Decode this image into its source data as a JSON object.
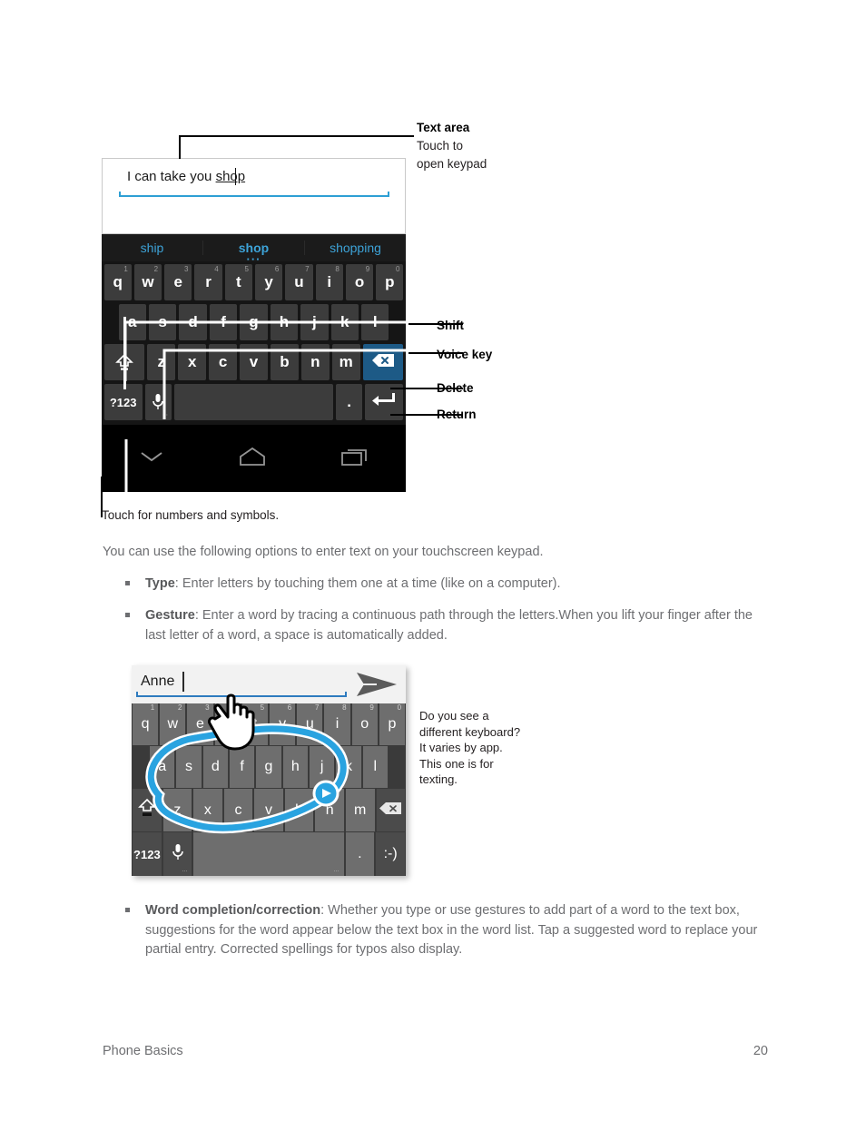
{
  "figure1": {
    "textarea": {
      "text_before": "I can take you ",
      "text_underlined": "shop"
    },
    "suggestions": [
      {
        "label": "ship",
        "active": false
      },
      {
        "label": "shop",
        "active": true
      },
      {
        "label": "shopping",
        "active": false
      }
    ],
    "rows": {
      "row1": [
        {
          "key": "q",
          "num": "1"
        },
        {
          "key": "w",
          "num": "2"
        },
        {
          "key": "e",
          "num": "3"
        },
        {
          "key": "r",
          "num": "4"
        },
        {
          "key": "t",
          "num": "5"
        },
        {
          "key": "y",
          "num": "6"
        },
        {
          "key": "u",
          "num": "7"
        },
        {
          "key": "i",
          "num": "8"
        },
        {
          "key": "o",
          "num": "9"
        },
        {
          "key": "p",
          "num": "0"
        }
      ],
      "row2": [
        {
          "key": "a"
        },
        {
          "key": "s"
        },
        {
          "key": "d"
        },
        {
          "key": "f"
        },
        {
          "key": "g"
        },
        {
          "key": "h"
        },
        {
          "key": "j"
        },
        {
          "key": "k"
        },
        {
          "key": "l"
        }
      ],
      "row3": [
        {
          "key": "shift"
        },
        {
          "key": "z"
        },
        {
          "key": "x"
        },
        {
          "key": "c"
        },
        {
          "key": "v"
        },
        {
          "key": "b"
        },
        {
          "key": "n"
        },
        {
          "key": "m"
        },
        {
          "key": "delete"
        }
      ],
      "row4": [
        {
          "key": "?123"
        },
        {
          "key": "mic"
        },
        {
          "key": "space"
        },
        {
          "key": "."
        },
        {
          "key": "return"
        }
      ]
    },
    "navbar": [
      "hide-keyboard-icon",
      "home-icon",
      "recents-icon"
    ],
    "callouts": [
      {
        "title": "Text area",
        "sub1": "Touch to",
        "sub2": "open keypad"
      },
      {
        "title": "Shift"
      },
      {
        "title": "Voice key"
      },
      {
        "title": "Delete"
      },
      {
        "title": "Return"
      }
    ],
    "caption": "Touch for numbers and symbols."
  },
  "body": {
    "intro": "You can use the following options to enter text on your touchscreen keypad.",
    "bullets": [
      {
        "term": "Type",
        "text": ": Enter letters by touching them one at a time (like on a computer)."
      },
      {
        "term": "Gesture",
        "text": ": Enter a word by tracing a continuous path through the letters.When you lift your finger after the last letter of a word, a space is automatically added."
      },
      {
        "term": "Word completion/correction",
        "text": ": Whether you type or use gestures to add part of a word to the text box, suggestions for the word appear below the text box in the word list. Tap a suggested word to replace your partial entry. Corrected spellings for typos also display."
      }
    ]
  },
  "figure2": {
    "textarea": {
      "text": "Anne"
    },
    "send_icon": "send-icon",
    "rows": {
      "row1": [
        {
          "key": "q",
          "num": "1"
        },
        {
          "key": "w",
          "num": "2"
        },
        {
          "key": "e",
          "num": "3"
        },
        {
          "key": "r",
          "num": "4"
        },
        {
          "key": "t",
          "num": "5"
        },
        {
          "key": "y",
          "num": "6"
        },
        {
          "key": "u",
          "num": "7"
        },
        {
          "key": "i",
          "num": "8"
        },
        {
          "key": "o",
          "num": "9"
        },
        {
          "key": "p",
          "num": "0"
        }
      ],
      "row2": [
        {
          "key": "a"
        },
        {
          "key": "s"
        },
        {
          "key": "d"
        },
        {
          "key": "f"
        },
        {
          "key": "g"
        },
        {
          "key": "h"
        },
        {
          "key": "j"
        },
        {
          "key": "k"
        },
        {
          "key": "l"
        }
      ],
      "row3": [
        {
          "key": "shift"
        },
        {
          "key": "z"
        },
        {
          "key": "x"
        },
        {
          "key": "c"
        },
        {
          "key": "v"
        },
        {
          "key": "b"
        },
        {
          "key": "n"
        },
        {
          "key": "m"
        },
        {
          "key": "delete"
        }
      ],
      "row4": [
        {
          "key": "?123"
        },
        {
          "key": "mic"
        },
        {
          "key": "space"
        },
        {
          "key": "."
        },
        {
          "key": ":-)"
        }
      ]
    },
    "note": "Do you see a different keyboard? It varies by app. This one is for texting.",
    "gesture_trace_color": "#29a3e0"
  },
  "footer": {
    "section": "Phone Basics",
    "page": "20"
  },
  "colors": {
    "accent_blue": "#3da3d8",
    "delete_key_blue": "#1d5a86",
    "gesture_blue": "#29a3e0",
    "body_text": "#6d6e71",
    "dark_key": "#3c3c3c",
    "light_key": "#6e6e6e"
  }
}
